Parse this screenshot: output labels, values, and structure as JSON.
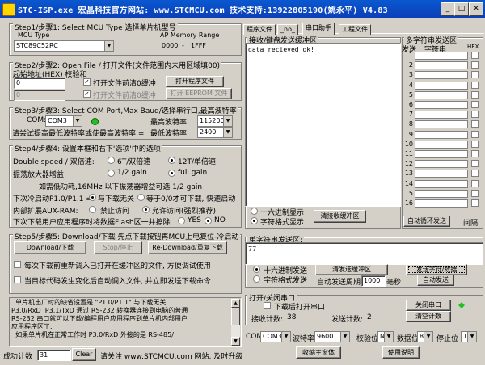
{
  "window": {
    "title": "STC-ISP.exe    宏晶科技官方网站: www.STCMCU.com   技术支持:13922805190(姚永平)   V4.83",
    "min": "_",
    "max": "□",
    "close": "✕"
  },
  "step1": {
    "legend": "Step1/步骤1: Select MCU Type  选择单片机型号",
    "mcu_type_label": "MCU Type",
    "ap_memory_label": "AP Memory Range",
    "mcu_value": "STC89C52RC",
    "range_start": "0000",
    "range_sep": "-",
    "range_end": "1FFF"
  },
  "step2": {
    "legend": "Step2/步骤2: Open File / 打开文件(文件范围内未用区域填00)",
    "addr_label": "起始地址(HEX) 校验和",
    "addr1": "0",
    "addr2": "0",
    "check1_label": "打开文件前清0缓冲",
    "check2_label": "打开文件前清0缓冲",
    "open_btn": "打开程序文件",
    "open_eeprom_btn": "打开 EEPROM 文件"
  },
  "step3": {
    "legend": "Step3/步骤3: Select COM Port,Max Baud/选择串行口,最高波特率",
    "com_label": "COM:",
    "com_value": "COM3",
    "max_baud_label": "最高波特率:",
    "max_baud_value": "115200",
    "hint": "请尝试提高最低波特率或使最高波特率 =",
    "min_baud_label": "最低波特率:",
    "min_baud_value": "2400",
    "led_color": "#22c022"
  },
  "step4": {
    "legend": "Step4/步骤4: 设置本框和右下'选项'中的选项",
    "double_speed_label": "Double speed / 双倍速:",
    "opt_6t": "6T/双倍速",
    "opt_12t": "12T/单倍速",
    "amp_label": "振荡放大器增益:",
    "opt_half": "1/2 gain",
    "opt_full": "full gain",
    "freq_note": "如需低功耗,16MHz 以下振荡器增益可选 1/2 gain",
    "p10_label": "下次冷启动P1.0/P1.1 =",
    "opt_p10_rel": "与下载无关",
    "opt_p10_eq": "等于0/0才可下载, 快速启动",
    "aux_label": "内部扩展AUX-RAM:",
    "opt_aux_off": "禁止访问",
    "opt_aux_on": "允许访问(强烈推荐)",
    "eeprom_label": "下次下载用户应用程序时将数据Flash区一并擦除",
    "opt_yes": "YES",
    "opt_no": "NO"
  },
  "step5": {
    "legend": "Step5/步骤5: Download/下载   先点下载按钮再MCU上电复位-冷启动",
    "download_btn": "Download/下载",
    "stop_btn": "Stop/停止",
    "redownload_btn": "Re-Download/重复下载",
    "check1": "每次下载前重新调入已打开在缓冲区的文件, 方便调试使用",
    "check2": "当目标代码发生变化后自动调入文件, 并立即发送下载命令"
  },
  "log": {
    "lines": [
      "  单片机出厂时的缺省设置是 \"P1.0/P1.1\" 与下载无关,",
      "P3.0/RxD  P3.1/TxD 通过 RS-232 转换器连接到电脑的普通",
      "RS-232 串口就可以下载/编程用户应用程序到单片机内部用户",
      "应用程序区了.",
      "  如果单片机在正常工作时 P3.0/RxD 外接的是 RS-485/"
    ]
  },
  "statusbar": {
    "success_label": "成功计数",
    "success_value": "31",
    "clear_btn": "Clear",
    "visit_text": "请关注 www.STCMCU.com 网站, 及时升级"
  },
  "tabs": [
    "程序文件",
    "_no_",
    "串口助手",
    "工程文件"
  ],
  "receive": {
    "legend": "接收/键盘发送缓冲区",
    "text": "data recieved ok!",
    "opt_hex": "十六进制显示",
    "opt_char": "字符格式显示",
    "clear_btn": "清接收缓冲区"
  },
  "multistring": {
    "legend": "多字符串发送区",
    "col_send": "发送",
    "col_str": "字符串",
    "col_hex": "HEX",
    "rows": [
      "1",
      "2",
      "3",
      "4",
      "5",
      "6",
      "7",
      "8",
      "9",
      "10",
      "11",
      "12",
      "13",
      "14",
      "15",
      "16"
    ],
    "auto_loop_btn": "自动循环发送",
    "interval_label": "间隔"
  },
  "single": {
    "legend": "单字符串发送区:",
    "text": "77",
    "opt_hex": "十六进制发送",
    "opt_char": "字符格式发送",
    "clear_btn": "清发送缓冲区",
    "send_btn": "发送字符/数据",
    "period_label": "自动发送周期",
    "period_value": "1000",
    "period_unit": "毫秒",
    "auto_btn": "自动发送"
  },
  "portctl": {
    "legend": "打开/关闭串口",
    "open_after_dl": "下载后打开串口",
    "close_btn": "关闭串口",
    "rx_label": "接收计数:",
    "rx_value": "38",
    "tx_label": "发送计数:",
    "tx_value": "2",
    "clear_count_btn": "清空计数"
  },
  "serial": {
    "com_label": "COM",
    "com_value": "COM3",
    "baud_label": "波特率",
    "baud_value": "9600",
    "parity_label": "校验位",
    "parity_value": "N",
    "data_label": "数据位",
    "data_value": "8",
    "stop_label": "停止位",
    "stop_value": "1",
    "pin_btn": "收缩主窗体",
    "help_btn": "使用说明"
  }
}
